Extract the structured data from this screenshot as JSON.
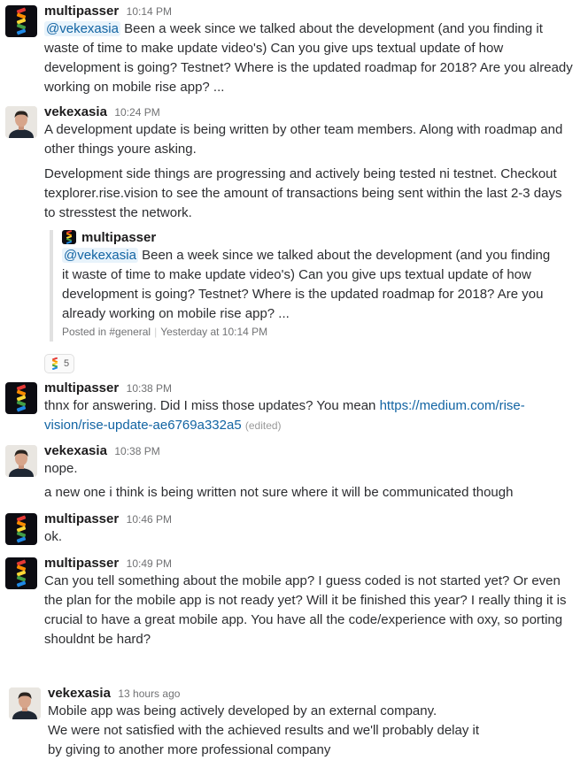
{
  "messages": [
    {
      "author": "multipasser",
      "time": "10:14 PM",
      "mention": "@vekexasia",
      "body": " Been a week since we talked about the development (and you finding it waste of time to make update video's) Can you give ups textual update of how development is going? Testnet? Where is the updated roadmap for 2018? Are you already working on mobile rise app? ..."
    },
    {
      "author": "vekexasia",
      "time": "10:24 PM",
      "paragraphs": [
        "A development update is being written by other team members. Along with roadmap and other things youre asking.",
        "Development side things are progressing and actively being tested ni testnet. Checkout texplorer.rise.vision to see the amount of transactions being sent within the last 2-3 days to stresstest the network."
      ],
      "quote": {
        "author": "multipasser",
        "mention": "@vekexasia",
        "body": " Been a week since we talked about the development (and you finding it waste of time to make update video's) Can you give ups textual update of how development is going? Testnet? Where is the updated roadmap for 2018? Are you already working on mobile rise app? ...",
        "posted_in": "Posted in #general",
        "posted_time": "Yesterday at 10:14 PM"
      },
      "reaction": {
        "emoji": "rise-logo",
        "count": "5"
      }
    },
    {
      "author": "multipasser",
      "time": "10:38 PM",
      "body": "thnx for answering. Did I miss those updates? You mean ",
      "link": "https://medium.com/rise-vision/rise-update-ae6769a332a5",
      "edited": "(edited)"
    },
    {
      "author": "vekexasia",
      "time": "10:38 PM",
      "paragraphs": [
        "nope.",
        "a new one i think is being written not sure where it will be communicated though"
      ]
    },
    {
      "author": "multipasser",
      "time": "10:46 PM",
      "body": "ok."
    },
    {
      "author": "multipasser",
      "time": "10:49 PM",
      "body": "Can you tell something about the mobile app? I guess coded is not started yet? Or even the plan for the mobile app is not ready yet?  Will it be finished this year?  I really thing it is crucial to have a great mobile app. You have all the code/experience with oxy, so porting shouldnt be hard?"
    },
    {
      "author": "vekexasia",
      "time": "13 hours ago",
      "lines": [
        "Mobile app was being actively developed by an external company.",
        "We were not satisfied with the achieved results and we'll probably delay it",
        "by giving to another more professional company"
      ]
    }
  ],
  "colors": {
    "link": "#1264a3",
    "mention_bg": "#e8f3fb",
    "rise_stripes": [
      "#e53935",
      "#fb8c00",
      "#fdd835",
      "#43a047",
      "#1e88e5"
    ]
  }
}
